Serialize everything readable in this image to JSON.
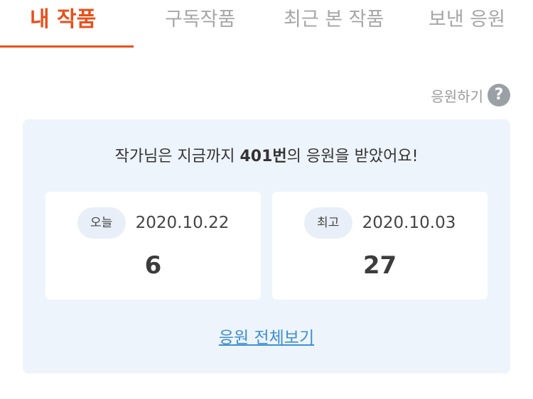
{
  "tabs": [
    {
      "label": "내 작품",
      "active": true
    },
    {
      "label": "구독작품",
      "active": false
    },
    {
      "label": "최근 본 작품",
      "active": false
    },
    {
      "label": "보낸 응원",
      "active": false
    }
  ],
  "help": {
    "label": "응원하기",
    "icon": "?"
  },
  "summary": {
    "prefix": "작가님은 지금까지 ",
    "count": "401번",
    "suffix": "의 응원을 받았어요!"
  },
  "stats": {
    "today": {
      "label": "오늘",
      "date": "2020.10.22",
      "value": "6"
    },
    "best": {
      "label": "최고",
      "date": "2020.10.03",
      "value": "27"
    }
  },
  "view_all_label": "응원 전체보기",
  "colors": {
    "accent": "#e8501b",
    "panel_bg": "#eef4fc",
    "link": "#3d8fd1",
    "tab_inactive": "#a6a6a6"
  }
}
